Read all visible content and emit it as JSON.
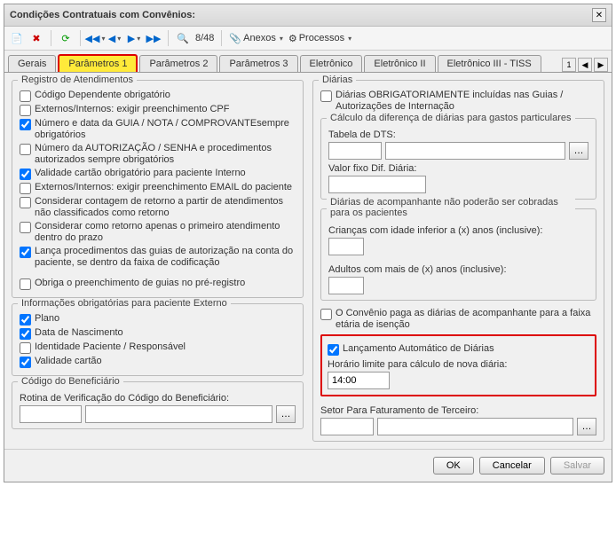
{
  "window": {
    "title": "Condições Contratuais com Convênios:"
  },
  "toolbar": {
    "counter": "8/48",
    "anexos": "Anexos",
    "processos": "Processos"
  },
  "tabs": {
    "gerais": "Gerais",
    "param1": "Parâmetros 1",
    "param2": "Parâmetros 2",
    "param3": "Parâmetros 3",
    "eletron": "Eletrônico",
    "eletron2": "Eletrônico II",
    "eletron3": "Eletrônico III - TISS",
    "extra": "1"
  },
  "left": {
    "reg_atend": "Registro de Atendimentos",
    "c1": "Código Dependente obrigatório",
    "c2": "Externos/Internos: exigir preenchimento CPF",
    "c3": "Número e data da GUIA / NOTA / COMPROVANTEsempre obrigatórios",
    "c4": "Número da AUTORIZAÇÃO / SENHA e procedimentos autorizados sempre obrigatórios",
    "c5": "Validade cartão obrigatório para paciente Interno",
    "c6": "Externos/Internos: exigir preenchimento EMAIL do paciente",
    "c7": "Considerar contagem de retorno a partir de atendimentos não classificados como retorno",
    "c8": "Considerar como retorno apenas o primeiro atendimento dentro do prazo",
    "c9": "Lança procedimentos das guias de autorização na conta do paciente, se dentro da faixa de codificação",
    "c10": "Obriga o preenchimento de guias no pré-registro",
    "info_ext": "Informações obrigatórias para paciente Externo",
    "plano": "Plano",
    "datanasc": "Data de Nascimento",
    "ident": "Identidade Paciente / Responsável",
    "validade": "Validade cartão",
    "cod_benef": "Código do Beneficiário",
    "rotina": "Rotina de Verificação do Código do Beneficiário:"
  },
  "right": {
    "diarias": "Diárias",
    "d1": "Diárias OBRIGATORIAMENTE incluídas nas Guias / Autorizações de Internação",
    "calc_dif": "Cálculo da diferença de diárias para gastos particulares",
    "tabela_dts": "Tabela de DTS:",
    "valor_fixo": "Valor fixo Dif. Diária:",
    "acomp": "Diárias de acompanhante não poderão ser cobradas para os pacientes",
    "criancas": "Crianças com idade inferior a (x) anos (inclusive):",
    "adultos": "Adultos com mais de (x) anos (inclusive):",
    "conv_paga": "O Convênio paga as diárias de acompanhante para a faixa etária de isenção",
    "lanc_auto": "Lançamento Automático de Diárias",
    "horario_lbl": "Horário limite para cálculo de nova diária:",
    "horario_val": "14:00",
    "setor": "Setor Para Faturamento de Terceiro:"
  },
  "buttons": {
    "ok": "OK",
    "cancelar": "Cancelar",
    "salvar": "Salvar"
  }
}
